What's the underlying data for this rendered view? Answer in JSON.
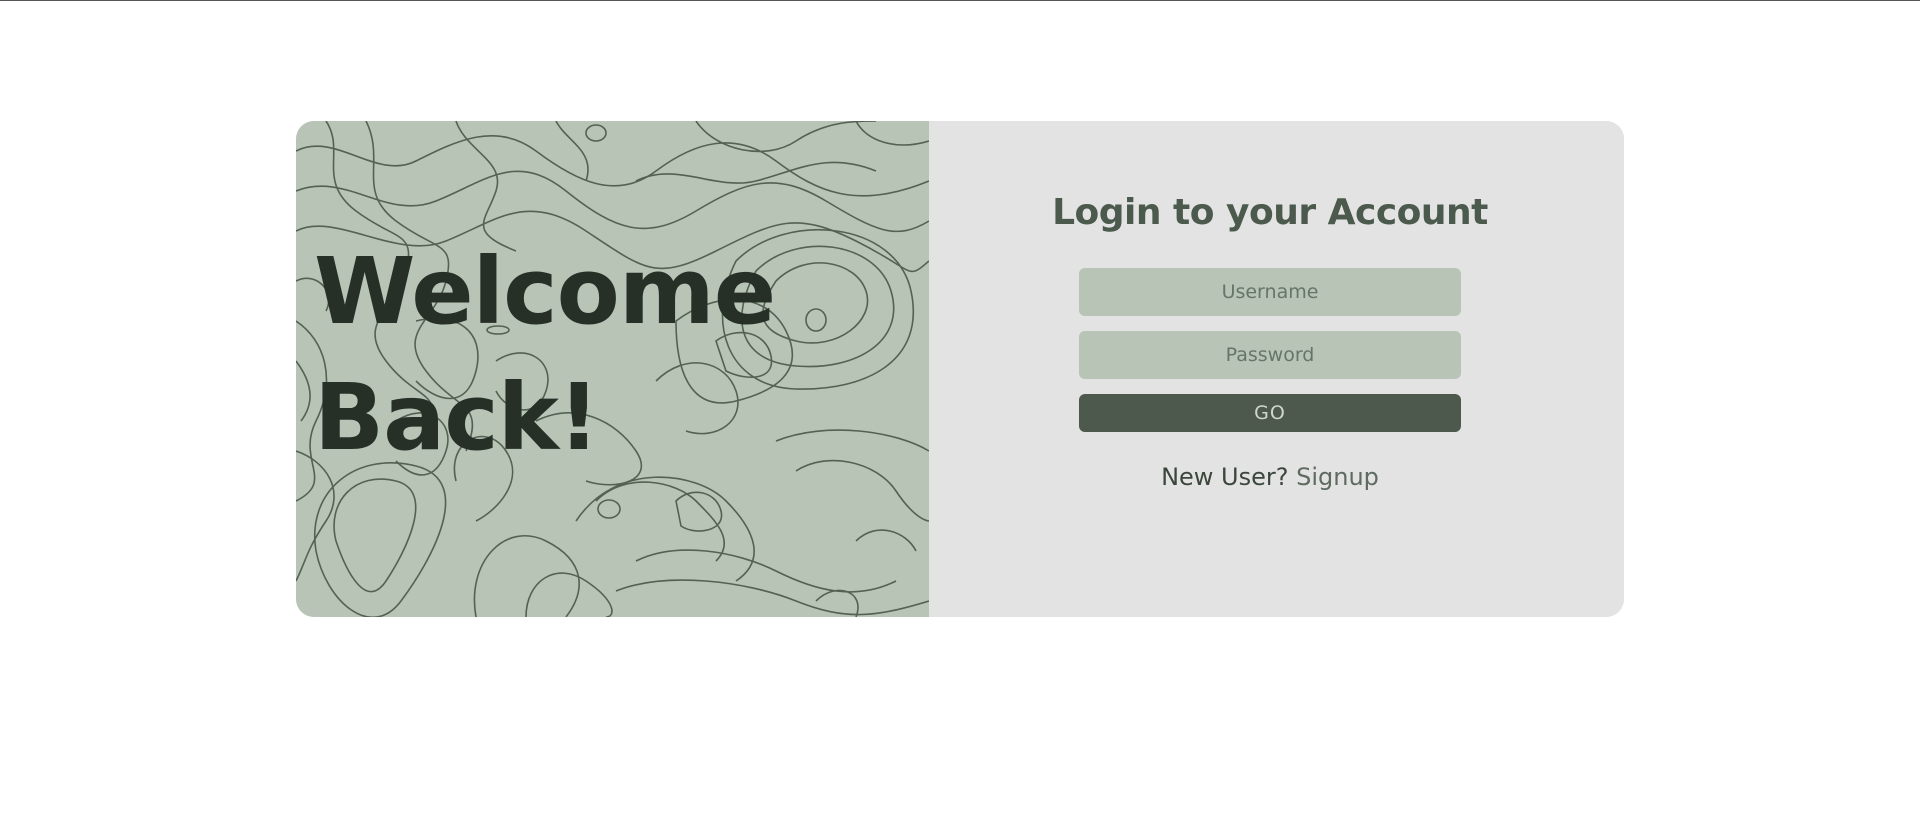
{
  "hero": {
    "line1": "Welcome",
    "line2": "Back!"
  },
  "login": {
    "title": "Login to your Account",
    "username_placeholder": "Username",
    "password_placeholder": "Password",
    "go_label": "GO",
    "new_user_text": "New User?",
    "signup_label": "Signup"
  },
  "colors": {
    "hero_bg": "#b7c4b6",
    "panel_bg": "#e3e3e3",
    "button_bg": "#4d594d",
    "title_text": "#4b5a4c",
    "hero_text": "#263027"
  }
}
